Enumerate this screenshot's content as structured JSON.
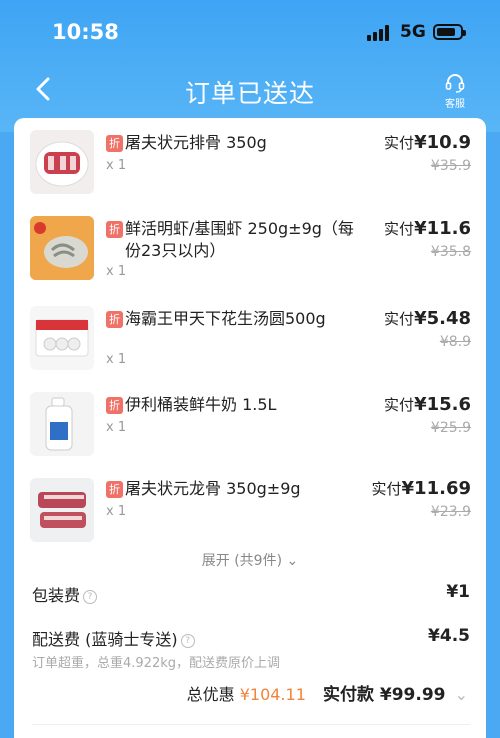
{
  "status_bar": {
    "time": "10:58",
    "network": "5G"
  },
  "nav": {
    "title": "订单已送达",
    "service_label": "客服"
  },
  "discount_badge": "折",
  "items": [
    {
      "name": "屠夫状元排骨 350g",
      "qty": "x 1",
      "pay_label": "实付",
      "price": "¥10.9",
      "original": "¥35.9"
    },
    {
      "name": "鲜活明虾/基围虾 250g±9g（每份23只以内）",
      "qty": "x 1",
      "pay_label": "实付",
      "price": "¥11.6",
      "original": "¥35.8"
    },
    {
      "name": "海霸王甲天下花生汤圆500g",
      "qty": "x 1",
      "pay_label": "实付",
      "price": "¥5.48",
      "original": "¥8.9"
    },
    {
      "name": "伊利桶装鲜牛奶 1.5L",
      "qty": "x 1",
      "pay_label": "实付",
      "price": "¥15.6",
      "original": "¥25.9"
    },
    {
      "name": "屠夫状元龙骨 350g±9g",
      "qty": "x 1",
      "pay_label": "实付",
      "price": "¥11.69",
      "original": "¥23.9"
    }
  ],
  "expand_label": "展开 (共9件) ⌄",
  "packing_fee": {
    "label": "包装费",
    "amount": "¥1"
  },
  "delivery_fee": {
    "label": "配送费 (蓝骑士专送)",
    "amount": "¥4.5",
    "note": "订单超重，总重4.922kg，配送费原价上调"
  },
  "summary": {
    "discount_label": "总优惠",
    "discount_value": "¥104.11",
    "paid_label": "实付款",
    "paid_value": "¥99.99"
  },
  "colors": {
    "header": "#3ea4f4",
    "badge": "#f07167",
    "discount": "#f0843c"
  }
}
